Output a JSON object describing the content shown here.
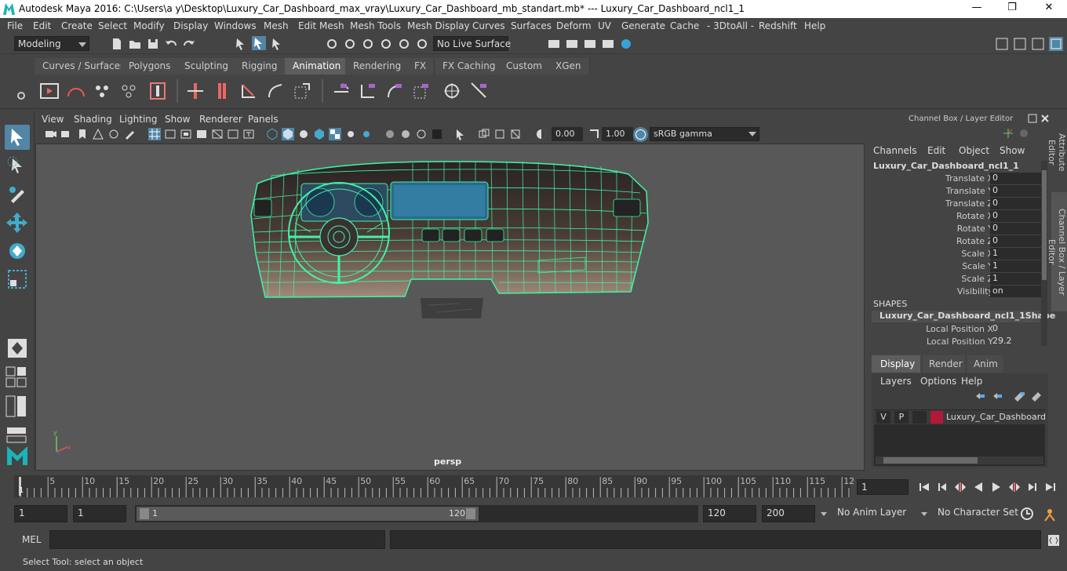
{
  "titlebar": {
    "title": "Autodesk Maya 2016: C:\\Users\\a y\\Desktop\\Luxury_Car_Dashboard_max_vray\\Luxury_Car_Dashboard_mb_standart.mb*   ---   Luxury_Car_Dashboard_ncl1_1",
    "minimize": "—",
    "maximize": "❐",
    "close": "✕"
  },
  "menu": [
    "File",
    "Edit",
    "Create",
    "Select",
    "Modify",
    "Display",
    "Windows",
    "Mesh",
    "Edit Mesh",
    "Mesh Tools",
    "Mesh Display",
    "Curves",
    "Surfaces",
    "Deform",
    "UV",
    "Generate",
    "Cache",
    "- 3DtoAll -",
    "Redshift",
    "Help"
  ],
  "status": {
    "mode": "Modeling",
    "live_surface": "No Live Surface"
  },
  "shelf_tabs": [
    "Curves / Surfaces",
    "Polygons",
    "Sculpting",
    "Rigging",
    "Animation",
    "Rendering",
    "FX",
    "FX Caching",
    "Custom",
    "XGen"
  ],
  "active_shelf_tab": "Animation",
  "viewport": {
    "menu": [
      "View",
      "Shading",
      "Lighting",
      "Show",
      "Renderer",
      "Panels"
    ],
    "exposure": "0.00",
    "gamma": "1.00",
    "color_space": "sRGB gamma",
    "camera": "persp"
  },
  "channel_box": {
    "header": "Channel Box / Layer Editor",
    "menu": [
      "Channels",
      "Edit",
      "Object",
      "Show"
    ],
    "object": "Luxury_Car_Dashboard_ncl1_1",
    "channels": [
      {
        "label": "Translate X",
        "value": "0"
      },
      {
        "label": "Translate Y",
        "value": "0"
      },
      {
        "label": "Translate Z",
        "value": "0"
      },
      {
        "label": "Rotate X",
        "value": "0"
      },
      {
        "label": "Rotate Y",
        "value": "0"
      },
      {
        "label": "Rotate Z",
        "value": "0"
      },
      {
        "label": "Scale X",
        "value": "1"
      },
      {
        "label": "Scale Y",
        "value": "1"
      },
      {
        "label": "Scale Z",
        "value": "1"
      },
      {
        "label": "Visibility",
        "value": "on"
      }
    ],
    "shapes_header": "SHAPES",
    "shape_name": "Luxury_Car_Dashboard_ncl1_1Shape",
    "shape_channels": [
      {
        "label": "Local Position X",
        "value": "0"
      },
      {
        "label": "Local Position Y",
        "value": "29.2"
      }
    ]
  },
  "side_tabs": {
    "attribute_editor": "Attribute Editor",
    "channel_box": "Channel Box / Layer Editor"
  },
  "layer_editor": {
    "tabs": [
      "Display",
      "Render",
      "Anim"
    ],
    "active_tab": "Display",
    "menu": [
      "Layers",
      "Options",
      "Help"
    ],
    "layers": [
      {
        "v": "V",
        "p": "P",
        "name": "Luxury_Car_Dashboard",
        "color": "#b0193a"
      }
    ]
  },
  "timeline": {
    "ticks": [
      "5",
      "10",
      "15",
      "20",
      "25",
      "30",
      "35",
      "40",
      "45",
      "50",
      "55",
      "60",
      "65",
      "70",
      "75",
      "80",
      "85",
      "90",
      "95",
      "100",
      "105",
      "110",
      "115",
      "12"
    ],
    "start_marker": "1",
    "current_frame": "1"
  },
  "range": {
    "start": "1",
    "playback_start": "1",
    "slider_start": "1",
    "slider_end": "120",
    "playback_end": "120",
    "end": "200",
    "anim_layer": "No Anim Layer",
    "character_set": "No Character Set"
  },
  "command": {
    "label": "MEL"
  },
  "help_line": "Select Tool: select an object",
  "colors": {
    "accent": "#5285a6",
    "wire": "#3ef5a8"
  }
}
